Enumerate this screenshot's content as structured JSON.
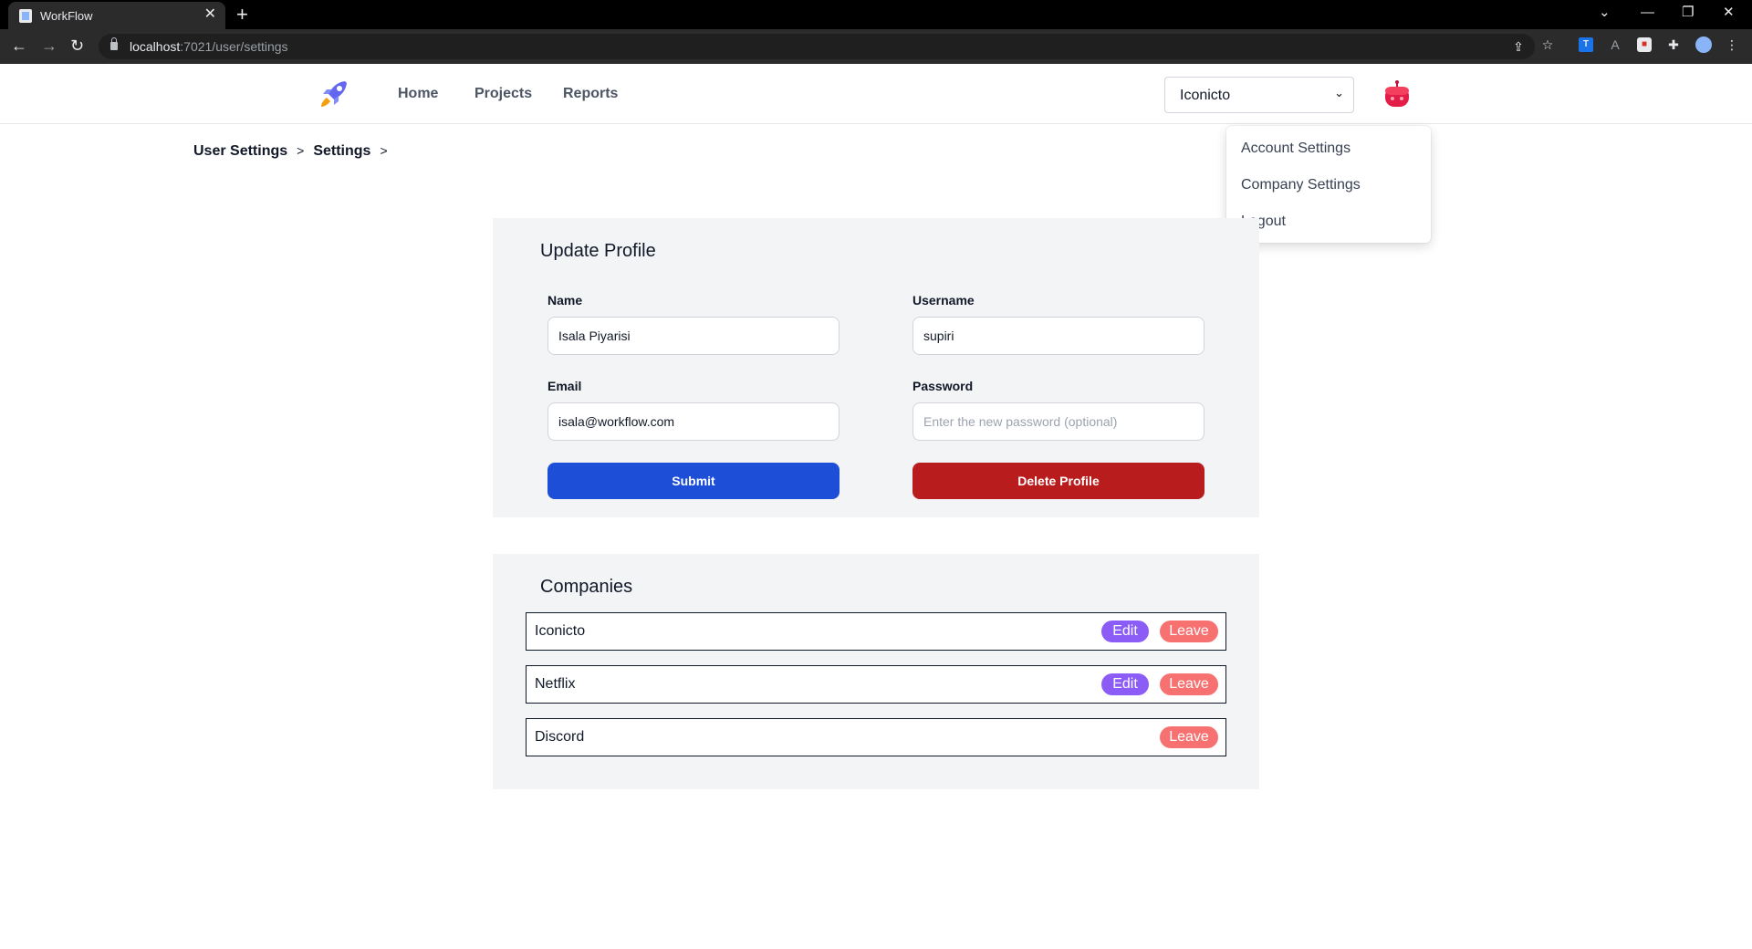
{
  "browser": {
    "tab_title": "WorkFlow",
    "tab_close": "✕",
    "new_tab": "+",
    "url_host": "localhost",
    "url_path": ":7021/user/settings",
    "window_controls": [
      "⌄",
      "—",
      "❐",
      "✕"
    ]
  },
  "nav": {
    "links": [
      "Home",
      "Projects",
      "Reports"
    ],
    "company_select_value": "Iconicto",
    "company_select_chevron": "⌄"
  },
  "dropdown": {
    "items": [
      "Account Settings",
      "Company Settings",
      "Logout"
    ]
  },
  "breadcrumb": {
    "items": [
      "User Settings",
      "Settings"
    ],
    "separator": ">"
  },
  "profile": {
    "title": "Update Profile",
    "name_label": "Name",
    "name_value": "Isala Piyarisi",
    "username_label": "Username",
    "username_value": "supiri",
    "email_label": "Email",
    "email_value": "isala@workflow.com",
    "password_label": "Password",
    "password_placeholder": "Enter the new password (optional)",
    "submit_label": "Submit",
    "delete_label": "Delete Profile"
  },
  "companies": {
    "title": "Companies",
    "edit_label": "Edit",
    "leave_label": "Leave",
    "rows": [
      {
        "name": "Iconicto",
        "editable": true
      },
      {
        "name": "Netflix",
        "editable": true
      },
      {
        "name": "Discord",
        "editable": false
      }
    ]
  },
  "colors": {
    "submit": "#1d4ed8",
    "delete": "#b91c1c",
    "edit_pill": "#8b5cf6",
    "leave_pill": "#f87171"
  }
}
